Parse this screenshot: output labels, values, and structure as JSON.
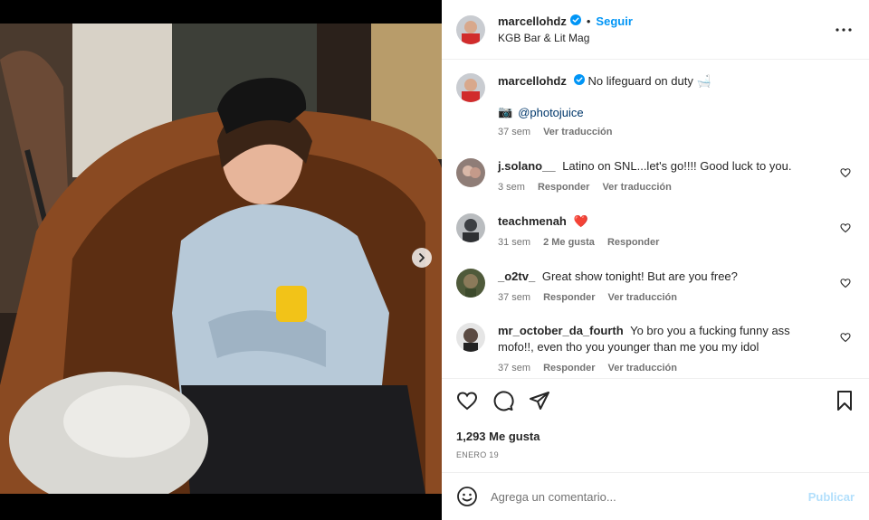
{
  "post": {
    "username": "marcellohdz",
    "follow_label": "Seguir",
    "location": "KGB Bar & Lit Mag",
    "more_icon": "more-horizontal-icon"
  },
  "caption": {
    "username": "marcellohdz",
    "text": "No lifeguard on duty 🛁",
    "credit_emoji": "📷",
    "credit_handle": "@photojuice",
    "time": "37 sem",
    "translate": "Ver traducción"
  },
  "comments": [
    {
      "username": "j.solano__",
      "text": "Latino on SNL...let's go!!!! Good luck to you.",
      "time": "3 sem",
      "reply": "Responder",
      "translate": "Ver traducción"
    },
    {
      "username": "teachmenah",
      "text": "❤️",
      "time": "31 sem",
      "likes": "2 Me gusta",
      "reply": "Responder"
    },
    {
      "username": "_o2tv_",
      "text": "Great show tonight! But are you free?",
      "time": "37 sem",
      "reply": "Responder",
      "translate": "Ver traducción"
    },
    {
      "username": "mr_october_da_fourth",
      "text": "Yo bro you a fucking funny ass mofo!!, even tho you younger than me you my idol",
      "time": "37 sem",
      "reply": "Responder",
      "translate": "Ver traducción"
    }
  ],
  "stats": {
    "likes": "1,293 Me gusta",
    "date": "ENERO 19"
  },
  "composer": {
    "placeholder": "Agrega un comentario...",
    "publish": "Publicar"
  },
  "carousel": {
    "slides": 3,
    "current": 1
  },
  "colors": {
    "accent": "#0095f6",
    "verified": "#0095f6",
    "heart": "#ed4956"
  }
}
